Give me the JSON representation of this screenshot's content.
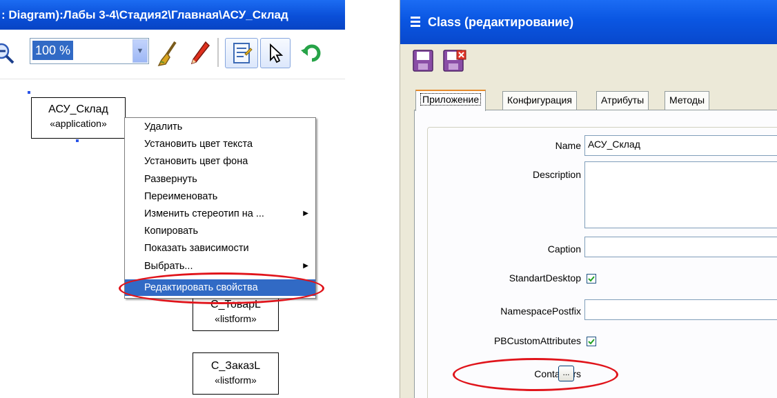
{
  "diagram": {
    "title": ": Diagram):Лабы 3-4\\Стадия2\\Главная\\АСУ_Склад",
    "toolbar": {
      "zoom_value": "100 %",
      "icons": [
        "zoom-out-icon",
        "dropdown-arrow-icon",
        "brush-icon",
        "pencil-icon",
        "notepad-icon",
        "pointer-arrow-icon",
        "undo-icon"
      ]
    },
    "elements": [
      {
        "name": "АСУ_Склад",
        "stereotype": "«application»"
      },
      {
        "name": "С_ТоварL",
        "stereotype": "«listform»"
      },
      {
        "name": "С_ЗаказL",
        "stereotype": "«listform»"
      }
    ],
    "context_menu": {
      "items": [
        {
          "label": "Удалить",
          "submenu": false
        },
        {
          "label": "Установить цвет текста",
          "submenu": false
        },
        {
          "label": "Установить цвет фона",
          "submenu": false
        },
        {
          "label": "Развернуть",
          "submenu": false
        },
        {
          "label": "Переименовать",
          "submenu": false
        },
        {
          "label": "Изменить стереотип на ...",
          "submenu": true
        },
        {
          "label": "Копировать",
          "submenu": false
        },
        {
          "label": "Показать зависимости",
          "submenu": false
        },
        {
          "label": "Выбрать...",
          "submenu": true
        },
        {
          "label": "Редактировать свойства",
          "submenu": false,
          "highlighted": true
        }
      ]
    }
  },
  "class_window": {
    "title": "Class (редактирование)",
    "toolbar": {
      "icons": [
        "save-icon",
        "save-close-icon"
      ]
    },
    "tabs": [
      "Приложение",
      "Конфигурация",
      "Атрибуты",
      "Методы"
    ],
    "active_tab": "Приложение",
    "fields": {
      "name_label": "Name",
      "name_value": "АСУ_Склад",
      "description_label": "Description",
      "description_value": "",
      "caption_label": "Caption",
      "caption_value": "",
      "standart_desktop_label": "StandartDesktop",
      "standart_desktop_checked": true,
      "namespace_postfix_label": "NamespacePostfix",
      "namespace_postfix_value": "",
      "pb_custom_attributes_label": "PBCustomAttributes",
      "pb_custom_attributes_checked": true,
      "containers_label": "Containers",
      "containers_button_label": "..."
    }
  },
  "colors": {
    "titlebar_blue": "#0a56e2",
    "menu_highlight": "#316ac5",
    "annotation_red": "#e0141b",
    "window_bg": "#ece9d8"
  }
}
